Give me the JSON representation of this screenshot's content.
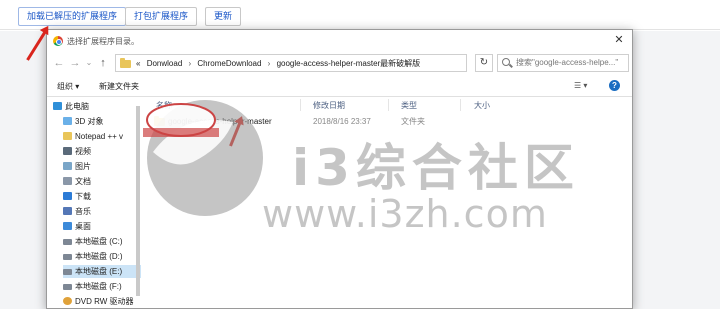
{
  "extensions_page": {
    "load_unpacked_label": "加载已解压的扩展程序",
    "pack_label": "打包扩展程序",
    "update_label": "更新"
  },
  "dialog": {
    "title": "选择扩展程序目录。",
    "close_glyph": "✕",
    "nav": {
      "back": "←",
      "forward": "→",
      "dropdown": "⌄",
      "up": "↑"
    },
    "breadcrumbs": [
      "«",
      "Donwload",
      "›",
      "ChromeDownload",
      "›",
      "google-access-helper-master最新破解版"
    ],
    "address_dropdown": "⌄",
    "refresh_glyph": "↻",
    "search_placeholder": "搜索\"google-access-helpe...\"",
    "toolbar": {
      "organize_label": "组织 ▾",
      "new_folder_label": "新建文件夹",
      "view_glyph": "☰ ▾",
      "help_glyph": "?"
    },
    "sidebar": [
      {
        "label": "此电脑",
        "icon": "computer-icon"
      },
      {
        "label": "3D 对象",
        "icon": "cube-icon"
      },
      {
        "label": "Notepad ++ v",
        "icon": "folder-icon"
      },
      {
        "label": "视频",
        "icon": "video-icon"
      },
      {
        "label": "图片",
        "icon": "picture-icon"
      },
      {
        "label": "文档",
        "icon": "document-icon"
      },
      {
        "label": "下载",
        "icon": "download-icon"
      },
      {
        "label": "音乐",
        "icon": "music-icon"
      },
      {
        "label": "桌面",
        "icon": "desktop-icon"
      },
      {
        "label": "本地磁盘 (C:)",
        "icon": "drive-icon"
      },
      {
        "label": "本地磁盘 (D:)",
        "icon": "drive-icon"
      },
      {
        "label": "本地磁盘 (E:)",
        "icon": "drive-icon"
      },
      {
        "label": "本地磁盘 (F:)",
        "icon": "drive-icon"
      },
      {
        "label": "DVD RW 驱动器",
        "icon": "dvd-icon"
      }
    ],
    "selected_sidebar_index": 11,
    "columns": [
      "名称",
      "修改日期",
      "类型",
      "大小"
    ],
    "files": [
      {
        "name": "google-access-helper-master",
        "modified": "2018/8/16 23:37",
        "type": "文件夹",
        "size": ""
      }
    ]
  },
  "watermark": {
    "text": "i3综合社区",
    "url": "www.i3zh.com"
  },
  "colors": {
    "accent_link": "#1a56c7",
    "annotation_red": "#d9251d",
    "selected_bg": "#cce4f7"
  }
}
